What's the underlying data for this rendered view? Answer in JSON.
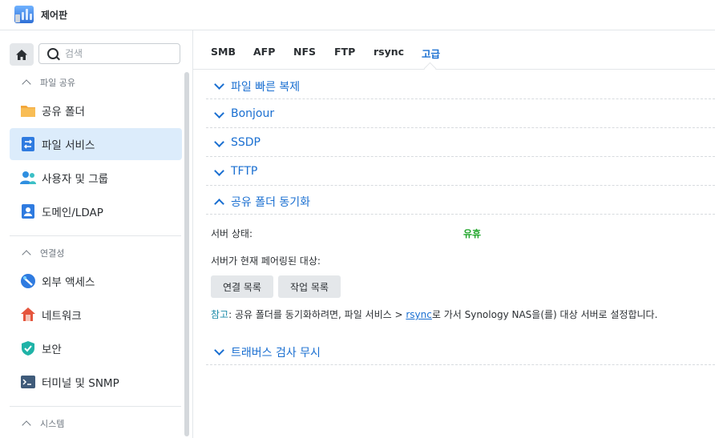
{
  "window": {
    "title": "제어판"
  },
  "sidebar": {
    "search_placeholder": "검색",
    "sections": {
      "file_sharing": "파일 공유",
      "connectivity": "연결성",
      "system": "시스템"
    },
    "items": [
      {
        "label": "공유 폴더",
        "icon": "folder-icon"
      },
      {
        "label": "파일 서비스",
        "icon": "file-services-icon"
      },
      {
        "label": "사용자 및 그룹",
        "icon": "users-icon"
      },
      {
        "label": "도메인/LDAP",
        "icon": "domain-icon"
      },
      {
        "label": "외부 액세스",
        "icon": "external-access-icon"
      },
      {
        "label": "네트워크",
        "icon": "network-icon"
      },
      {
        "label": "보안",
        "icon": "shield-icon"
      },
      {
        "label": "터미널 및 SNMP",
        "icon": "terminal-icon"
      }
    ]
  },
  "tabs": [
    "SMB",
    "AFP",
    "NFS",
    "FTP",
    "rsync",
    "고급"
  ],
  "accordion": {
    "fast_clone": "파일 빠른 복제",
    "bonjour": "Bonjour",
    "ssdp": "SSDP",
    "tftp": "TFTP",
    "shared_sync": "공유 폴더 동기화",
    "traverse": "트래버스 검사 무시"
  },
  "sync": {
    "server_status_label": "서버 상태:",
    "server_status_value": "유휴",
    "paired_label": "서버가 현재 페어링된 대상:",
    "connection_list_btn": "연결 목록",
    "task_list_btn": "작업 목록",
    "note_label": "참고",
    "note_prefix": ": 공유 폴더를 동기화하려면, 파일 서비스 > ",
    "note_link": "rsync",
    "note_suffix": "로 가서 Synology NAS을(를) 대상 서버로 설정합니다."
  },
  "colors": {
    "accent": "#1a6fd1",
    "active_bg": "#dcecfb",
    "status_ok": "#20a52a"
  }
}
